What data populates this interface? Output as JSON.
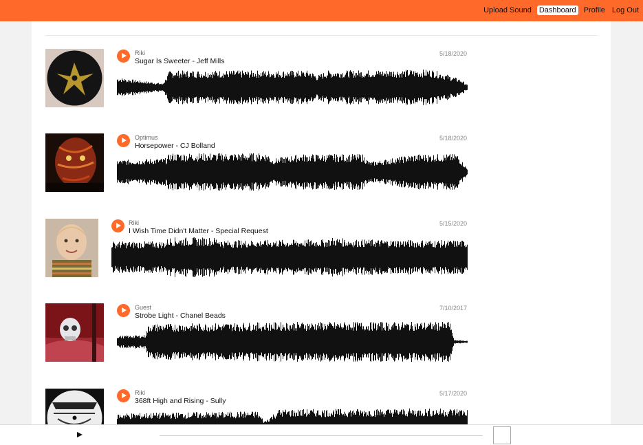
{
  "nav": {
    "upload": "Upload Sound",
    "dashboard": "Dashboard",
    "profile": "Profile",
    "logout": "Log Out"
  },
  "colors": {
    "accent": "#ff6a2b"
  },
  "tracks": [
    {
      "artist": "Riki",
      "title": "Sugar Is Sweeter - Jeff Mills",
      "date": "5/18/2020"
    },
    {
      "artist": "Optimus",
      "title": "Horsepower - CJ Bolland",
      "date": "5/18/2020"
    },
    {
      "artist": "Riki",
      "title": "I Wish Time Didn't Matter - Special Request",
      "date": "5/15/2020"
    },
    {
      "artist": "Guest",
      "title": "Strobe Light - Chanel Beads",
      "date": "7/10/2017"
    },
    {
      "artist": "Riki",
      "title": "368ft High and Rising - Sully",
      "date": "5/17/2020"
    }
  ],
  "player": {
    "play_icon": "play-icon"
  }
}
